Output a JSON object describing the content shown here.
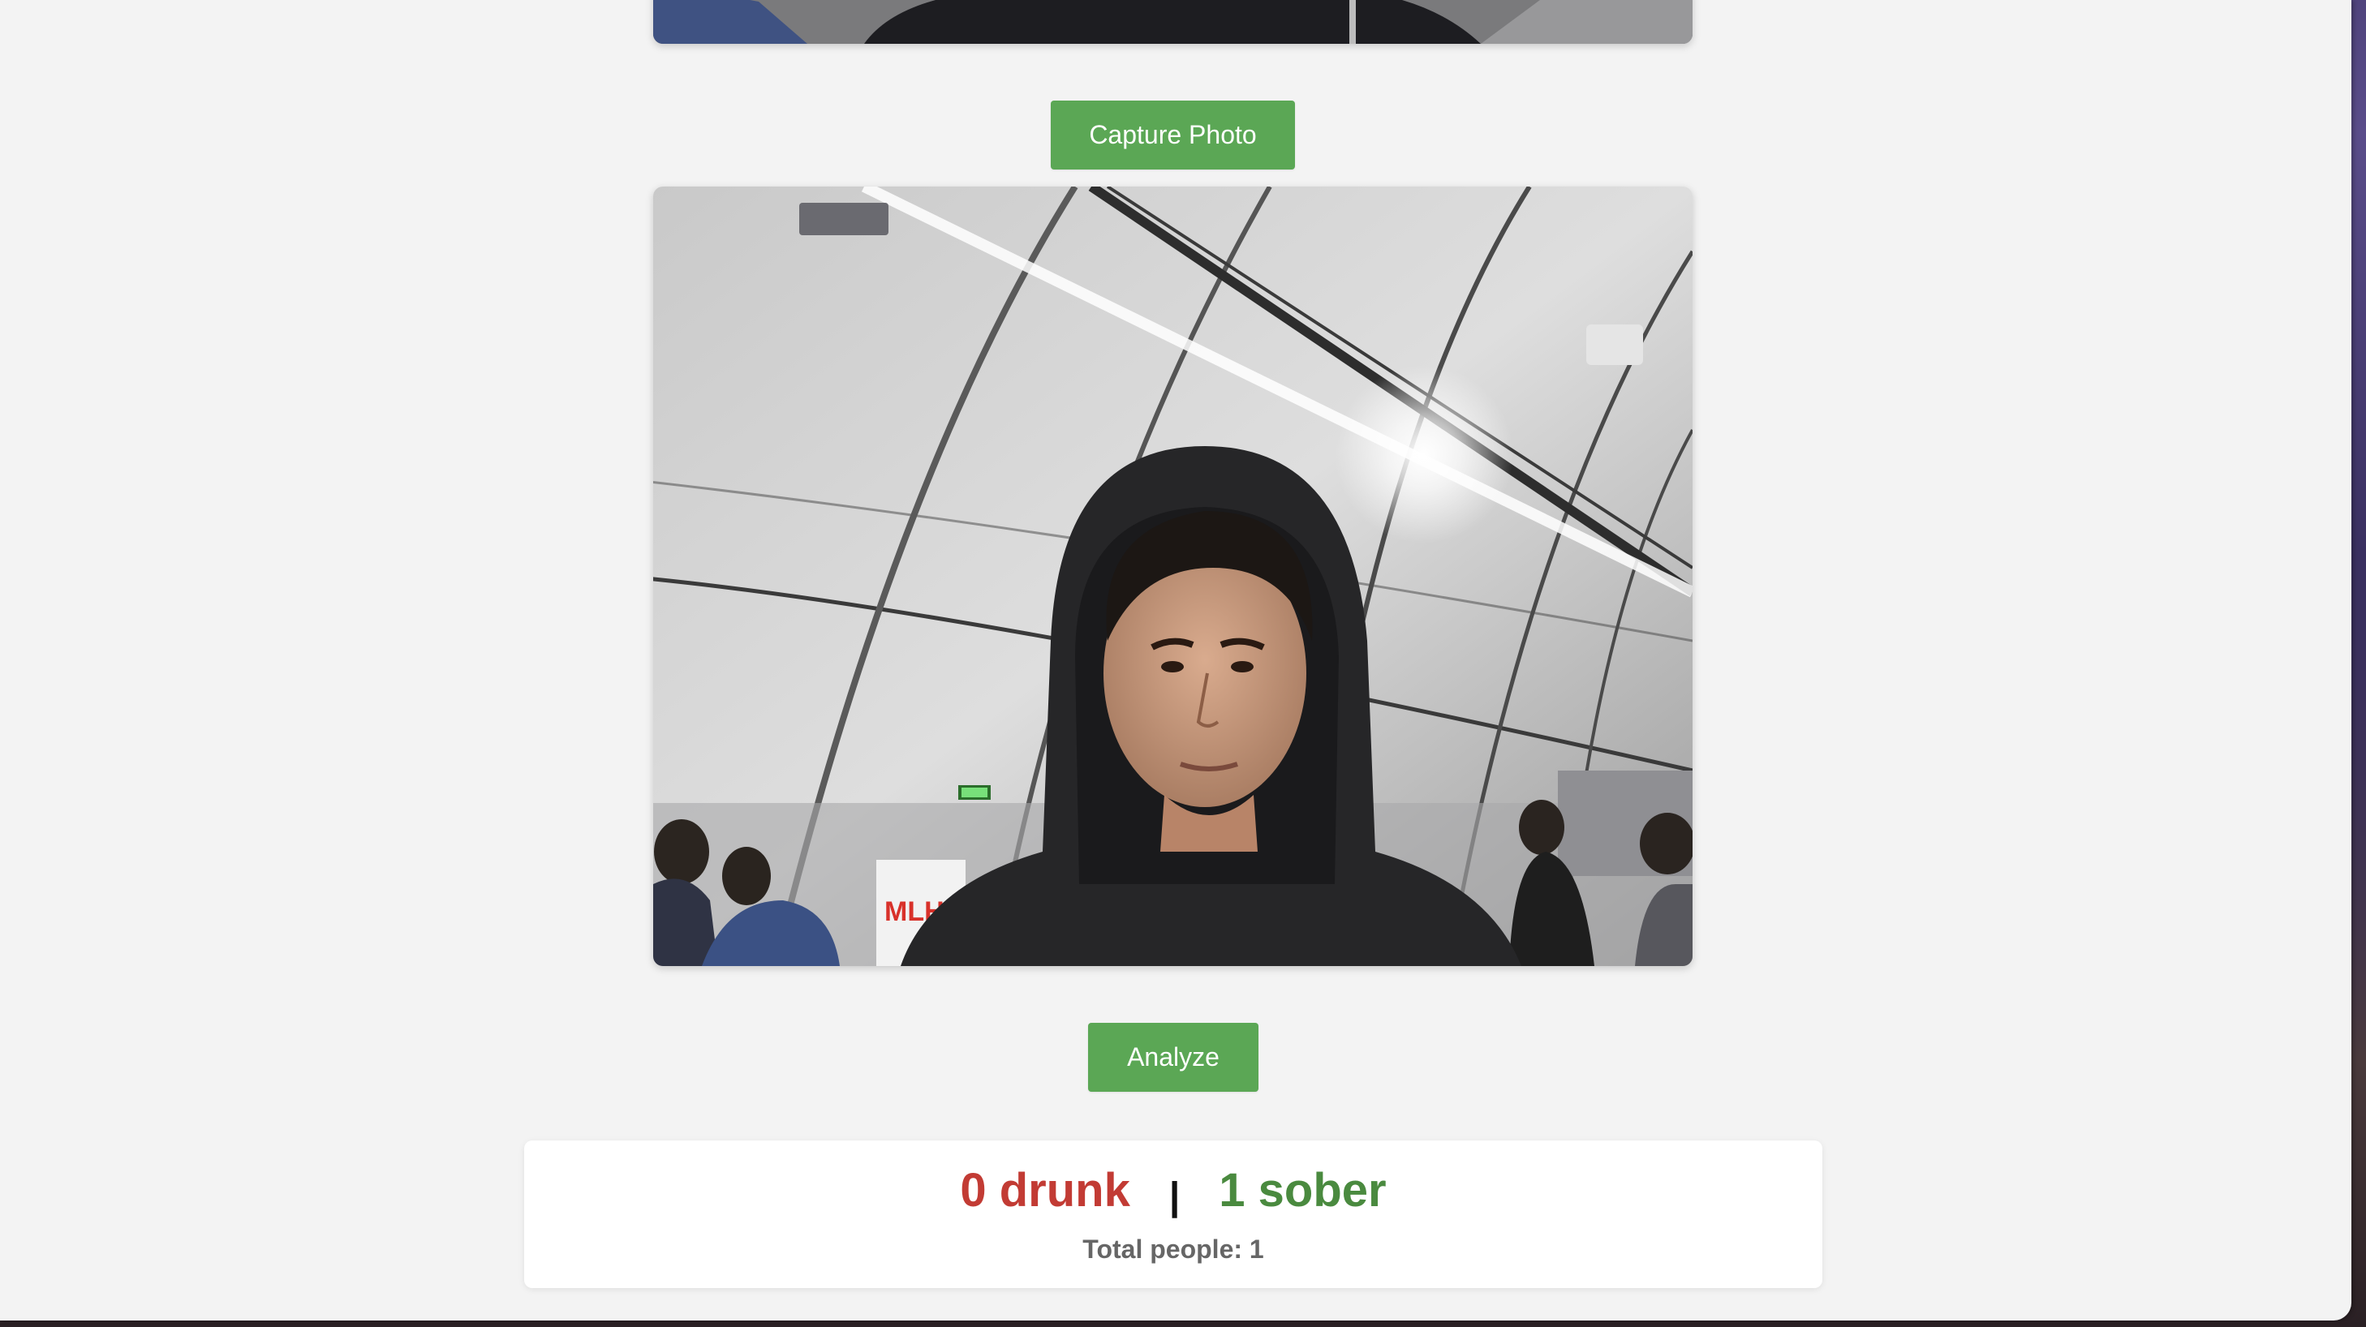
{
  "buttons": {
    "capture_label": "Capture Photo",
    "analyze_label": "Analyze"
  },
  "results": {
    "drunk_text": "0 drunk",
    "separator": "|",
    "sober_text": "1 sober",
    "total_text": "Total people: 1"
  },
  "photo": {
    "banner_text": "MLH"
  },
  "colors": {
    "button_green": "#5ba755",
    "drunk_red": "#c23b34",
    "sober_green": "#4a8a3f",
    "page_background": "#f3f3f3"
  }
}
